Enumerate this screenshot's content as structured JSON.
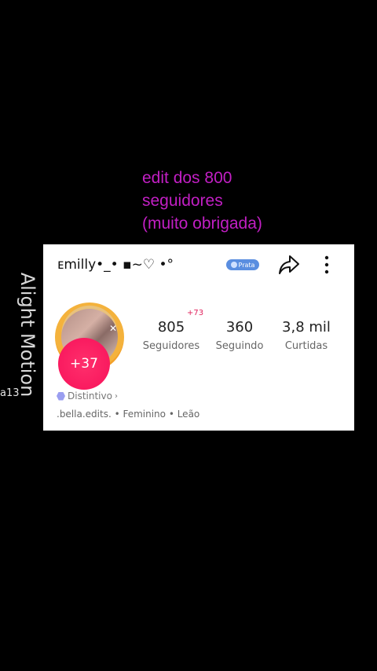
{
  "caption": {
    "line1": "edit dos 800",
    "line2": "seguidores",
    "line3": "(muito obrigada)"
  },
  "watermark": "Alight Motion",
  "side_handle": "a13",
  "profile": {
    "username": "ᴇmilly•_• ▪︎~♡ •°",
    "level_badge": "Prata",
    "avatar_badge": "+37",
    "new_followers_delta": "+73",
    "stats": {
      "followers_value": "805",
      "followers_label": "Seguidores",
      "following_value": "360",
      "following_label": "Seguindo",
      "likes_value": "3,8 mil",
      "likes_label": "Curtidas"
    },
    "distintivo_label": "Distintivo",
    "meta_line": ".bella.edits. • Feminino • Leão"
  },
  "colors": {
    "caption": "#c21fc4",
    "badge_pink": "#f7125a",
    "level_badge": "#5a8ee0",
    "avatar_ring": "#f3a129"
  },
  "icons": {
    "share": "share-arrow-icon",
    "more": "vertical-dots-icon",
    "distintivo": "hexagon-icon",
    "close": "close-icon"
  }
}
